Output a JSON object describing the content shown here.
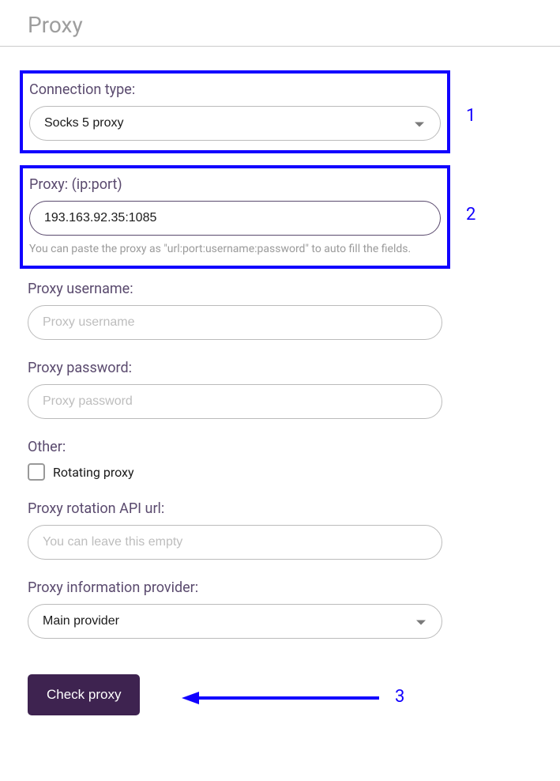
{
  "page_title": "Proxy",
  "connection_type": {
    "label": "Connection type:",
    "value": "Socks 5 proxy"
  },
  "proxy_ip": {
    "label": "Proxy: (ip:port)",
    "value": "193.163.92.35:1085",
    "help": "You can paste the proxy as \"url:port:username:password\" to auto fill the fields."
  },
  "proxy_username": {
    "label": "Proxy username:",
    "placeholder": "Proxy username"
  },
  "proxy_password": {
    "label": "Proxy password:",
    "placeholder": "Proxy password"
  },
  "other": {
    "label": "Other:",
    "checkbox_label": "Rotating proxy"
  },
  "rotation_api": {
    "label": "Proxy rotation API url:",
    "placeholder": "You can leave this empty"
  },
  "provider": {
    "label": "Proxy information provider:",
    "value": "Main provider"
  },
  "check_button": "Check proxy",
  "annotations": {
    "n1": "1",
    "n2": "2",
    "n3": "3"
  }
}
